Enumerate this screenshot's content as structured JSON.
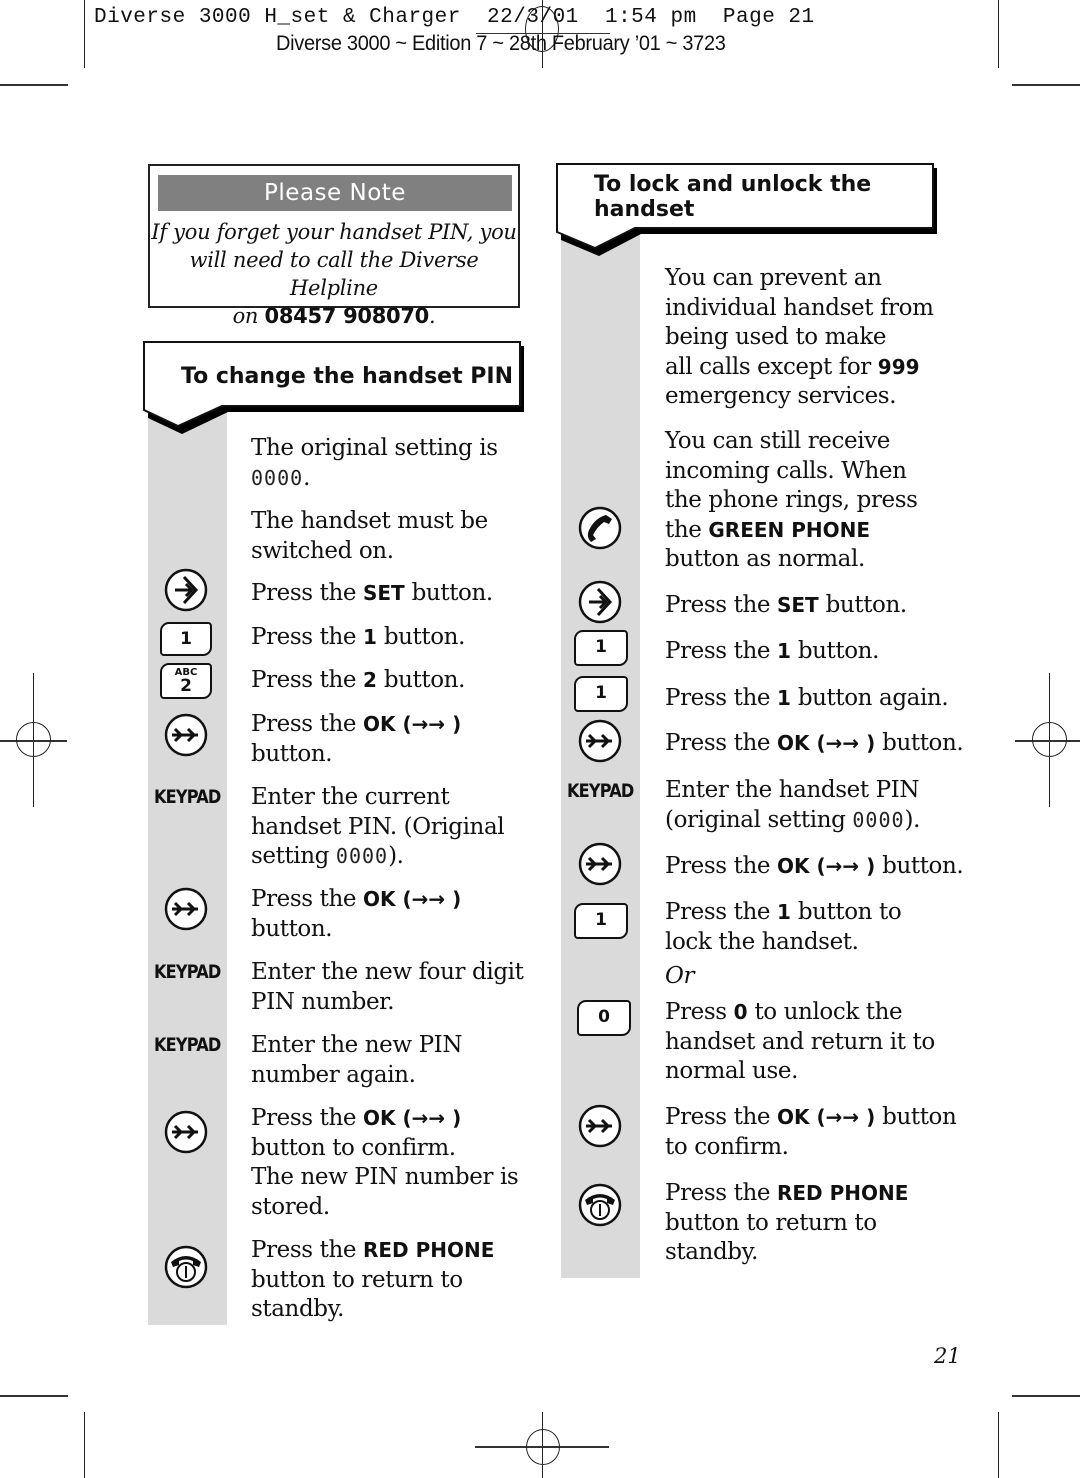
{
  "slug": {
    "line1": "Diverse 3000 H_set & Charger  22/3/01  1:54 pm  Page 21",
    "line2": "Diverse 3000 ~ Edition 7 ~ 28th February ’01 ~ 3723"
  },
  "note": {
    "title": "Please Note",
    "body_line1": "If you forget your handset PIN, you",
    "body_line2": "will need to call the Diverse Helpline",
    "body_line3_prefix": "on ",
    "phone": "08457 908070",
    "body_line3_suffix": "."
  },
  "left_section": {
    "title": "To change the handset PIN",
    "intro1_text": "The original setting is",
    "intro1_code": "0000",
    "intro2": [
      "The handset must be",
      "switched on."
    ],
    "steps": [
      {
        "icon": "set-button-icon",
        "pre": "Press the ",
        "bold": "SET",
        "post": " button."
      },
      {
        "icon": "key-1",
        "key": "1",
        "pre": "Press the ",
        "bold": "1",
        "post": " button."
      },
      {
        "icon": "key-2",
        "key": "2",
        "key_sub": "ABC",
        "pre": "Press the ",
        "bold": "2",
        "post": " button."
      },
      {
        "icon": "ok-button-icon",
        "pre": "Press the ",
        "bold": "OK (→→ )",
        "post": "button."
      },
      {
        "icon": "keypad",
        "label": "KEYPAD",
        "line1": "Enter the current",
        "line2": "handset PIN. (Original",
        "line3_pre": "setting ",
        "code": "0000",
        "line3_post": ")."
      },
      {
        "icon": "ok-button-icon",
        "pre": "Press the ",
        "bold": "OK (→→ )",
        "post": "button."
      },
      {
        "icon": "keypad",
        "label": "KEYPAD",
        "line1": "Enter the new four digit",
        "line2": "PIN number."
      },
      {
        "icon": "keypad",
        "label": "KEYPAD",
        "line1": "Enter the new PIN",
        "line2": "number again."
      },
      {
        "icon": "ok-button-icon",
        "pre": "Press the ",
        "bold": "OK (→→ )",
        "line2": "button to confirm.",
        "line3": "The new PIN number is",
        "line4": "stored."
      },
      {
        "icon": "red-phone-icon",
        "pre": "Press the ",
        "bold": "RED PHONE",
        "line2": "button to return to",
        "line3": "standby."
      }
    ]
  },
  "right_section": {
    "title_line1": "To lock and unlock the",
    "title_line2": "handset",
    "intro1": [
      "You can prevent an",
      "individual handset from",
      "being used to make"
    ],
    "intro1_last_pre": "all calls except for ",
    "intro1_last_bold": "999",
    "intro1_end": "emergency services.",
    "intro2": [
      "You can still receive",
      "incoming calls. When",
      "the phone rings, press"
    ],
    "intro2_pre": "the ",
    "intro2_bold": "GREEN PHONE",
    "intro2_end": "button as normal.",
    "steps": [
      {
        "icon": "set-button-icon",
        "pre": "Press the ",
        "bold": "SET",
        "post": " button."
      },
      {
        "icon": "key-1",
        "key": "1",
        "pre": "Press the ",
        "bold": "1",
        "post": " button."
      },
      {
        "icon": "key-1",
        "key": "1",
        "pre": "Press the ",
        "bold": "1",
        "post": " button again."
      },
      {
        "icon": "ok-button-icon",
        "pre": "Press the ",
        "bold": "OK (→→ )",
        "post": " button."
      },
      {
        "icon": "keypad",
        "label": "KEYPAD",
        "line1": "Enter the handset PIN",
        "line2_pre": "(original setting ",
        "code": "0000",
        "line2_post": ")."
      },
      {
        "icon": "ok-button-icon",
        "pre": "Press the ",
        "bold": "OK (→→ )",
        "post": " button."
      },
      {
        "icon": "key-1",
        "key": "1",
        "pre": "Press the ",
        "bold": "1",
        "post": " button to",
        "line2": "lock the handset."
      },
      {
        "or": "Or"
      },
      {
        "icon": "key-0",
        "key": "0",
        "pre": "Press ",
        "bold": "0",
        "post": " to unlock the",
        "line2": "handset and return it to",
        "line3": "normal use."
      },
      {
        "icon": "ok-button-icon",
        "pre": "Press the ",
        "bold": "OK (→→ )",
        "post": " button",
        "line2": "to confirm."
      },
      {
        "icon": "red-phone-icon",
        "pre": "Press the ",
        "bold": "RED PHONE",
        "line2": "button to return to",
        "line3": "standby."
      }
    ]
  },
  "page_number": "21"
}
